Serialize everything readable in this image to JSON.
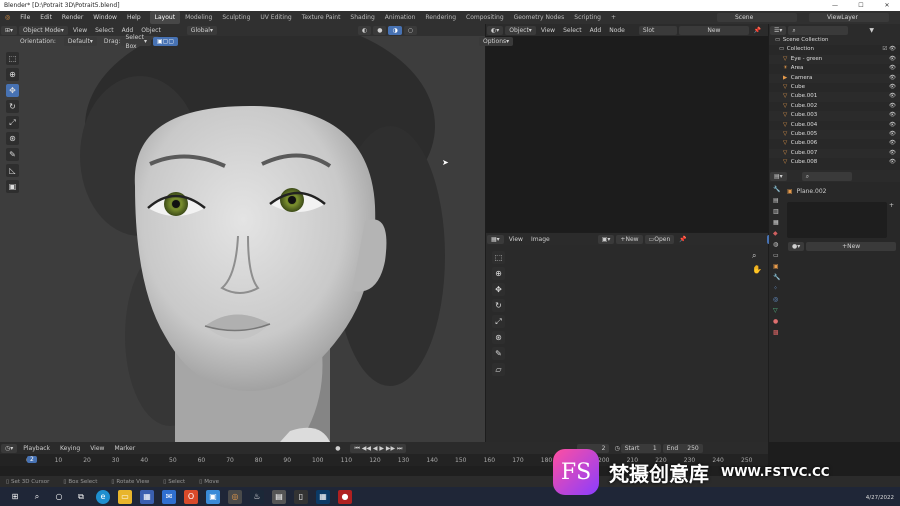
{
  "window": {
    "title": "Blender* [D:\\Potrait 3D\\Potrait5.blend]"
  },
  "menu": {
    "items": [
      "File",
      "Edit",
      "Render",
      "Window",
      "Help"
    ],
    "workspaces": [
      "Layout",
      "Modeling",
      "Sculpting",
      "UV Editing",
      "Texture Paint",
      "Shading",
      "Animation",
      "Rendering",
      "Compositing",
      "Geometry Nodes",
      "Scripting"
    ],
    "active_workspace": "Layout",
    "scene": "Scene",
    "view_layer": "ViewLayer"
  },
  "viewport": {
    "mode": "Object Mode",
    "menu": [
      "View",
      "Select",
      "Add",
      "Object"
    ],
    "transform": "Global",
    "orientation_label": "Orientation:",
    "orientation_value": "Default",
    "drag_label": "Drag:",
    "drag_value": "Select Box",
    "options": "Options"
  },
  "node_editor": {
    "type": "Object",
    "menu": [
      "View",
      "Select",
      "Add",
      "Node"
    ],
    "slot": "Slot",
    "new_label": "New"
  },
  "image_editor": {
    "menu": [
      "View",
      "Image"
    ],
    "new_label": "New",
    "open_label": "Open"
  },
  "outliner": {
    "root": "Scene Collection",
    "collection": "Collection",
    "items": [
      "Eye - green",
      "Area",
      "Camera",
      "Cube",
      "Cube.001",
      "Cube.002",
      "Cube.003",
      "Cube.004",
      "Cube.005",
      "Cube.006",
      "Cube.007",
      "Cube.008"
    ]
  },
  "properties": {
    "object_name": "Plane.002",
    "new_label": "New"
  },
  "timeline": {
    "menu": [
      "Playback",
      "Keying",
      "View",
      "Marker"
    ],
    "current_frame": "2",
    "start_label": "Start",
    "start": "1",
    "end_label": "End",
    "end": "250",
    "ticks": [
      "0",
      "10",
      "20",
      "30",
      "40",
      "50",
      "60",
      "70",
      "80",
      "90",
      "100",
      "110",
      "120",
      "130",
      "140",
      "150",
      "160",
      "170",
      "180",
      "190",
      "200",
      "210",
      "220",
      "230",
      "240",
      "250"
    ]
  },
  "status": {
    "items": [
      "Set 3D Cursor",
      "Box Select",
      "Rotate View",
      "Select",
      "Move"
    ]
  },
  "taskbar": {
    "date": "4/27/2022"
  },
  "watermark": {
    "logo": "FS",
    "text": "梵摄创意库",
    "url": "WWW.FSTVC.CC"
  }
}
